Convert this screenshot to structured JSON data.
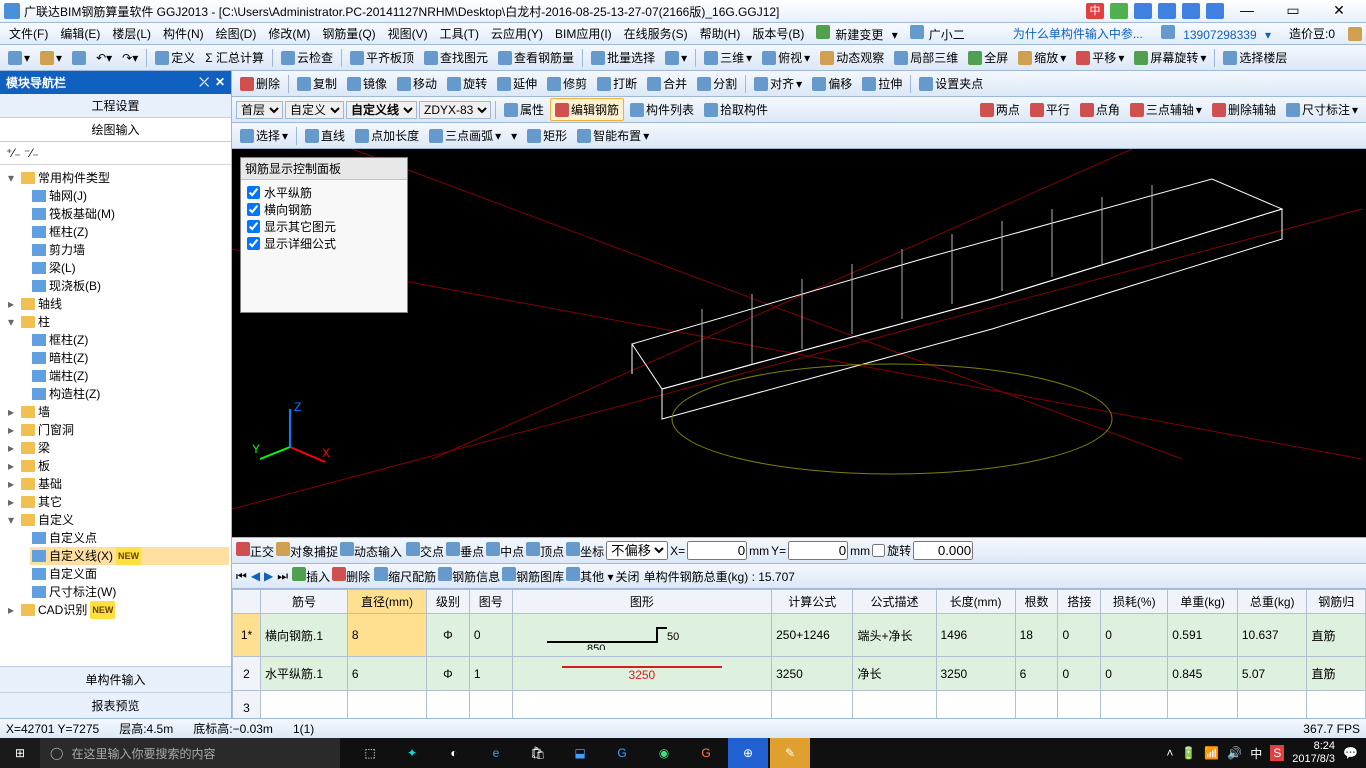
{
  "title": "广联达BIM钢筋算量软件 GGJ2013 - [C:\\Users\\Administrator.PC-20141127NRHM\\Desktop\\白龙村-2016-08-25-13-27-07(2166版)_16G.GGJ12]",
  "ime_text": "中",
  "menubar": [
    "文件(F)",
    "编辑(E)",
    "楼层(L)",
    "构件(N)",
    "绘图(D)",
    "修改(M)",
    "钢筋量(Q)",
    "视图(V)",
    "工具(T)",
    "云应用(Y)",
    "BIM应用(I)",
    "在线服务(S)",
    "帮助(H)",
    "版本号(B)"
  ],
  "menubar_right": {
    "new_change": "新建变更",
    "xiaoer": "广小二",
    "hint": "为什么单构件输入中参...",
    "phone": "13907298339",
    "coin": "造价豆:0"
  },
  "toolbar": [
    "定义",
    "Σ 汇总计算",
    "云检查",
    "平齐板顶",
    "查找图元",
    "查看钢筋量",
    "批量选择",
    "三维",
    "俯视",
    "动态观察",
    "局部三维",
    "全屏",
    "缩放",
    "平移",
    "屏幕旋转",
    "选择楼层"
  ],
  "nav": {
    "title": "模块导航栏",
    "tabs": {
      "project": "工程设置",
      "draw": "绘图输入"
    },
    "tree": {
      "root": "常用构件类型",
      "common": [
        "轴网(J)",
        "筏板基础(M)",
        "框柱(Z)",
        "剪力墙",
        "梁(L)",
        "现浇板(B)"
      ],
      "branches": [
        {
          "name": "轴线"
        },
        {
          "name": "柱",
          "children": [
            "框柱(Z)",
            "暗柱(Z)",
            "端柱(Z)",
            "构造柱(Z)"
          ]
        },
        {
          "name": "墙"
        },
        {
          "name": "门窗洞"
        },
        {
          "name": "梁"
        },
        {
          "name": "板"
        },
        {
          "name": "基础"
        },
        {
          "name": "其它"
        },
        {
          "name": "自定义",
          "children": [
            "自定义点",
            "自定义线(X)",
            "自定义面",
            "尺寸标注(W)"
          ]
        },
        {
          "name": "CAD识别"
        }
      ]
    },
    "bottom": [
      "单构件输入",
      "报表预览"
    ]
  },
  "worktb1": {
    "copy": "复制",
    "mirror": "镜像",
    "move": "移动",
    "rotate": "旋转",
    "extend": "延伸",
    "trim": "修剪",
    "break": "打断",
    "merge": "合并",
    "split": "分割",
    "align": "对齐",
    "offset": "偏移",
    "stretch": "拉伸",
    "setpt": "设置夹点",
    "delete": "删除"
  },
  "worktb2": {
    "floor": "首层",
    "user": "自定义",
    "userline": "自定义线",
    "code": "ZDYX-83",
    "attr": "属性",
    "editrebar": "编辑钢筋",
    "list": "构件列表",
    "pick": "拾取构件",
    "twopt": "两点",
    "parallel": "平行",
    "corner": "点角",
    "threept": "三点辅轴",
    "delaux": "删除辅轴",
    "dim": "尺寸标注"
  },
  "worktb3": {
    "select": "选择",
    "line": "直线",
    "ptlen": "点加长度",
    "arc": "三点画弧",
    "rect": "矩形",
    "smart": "智能布置"
  },
  "display_panel": {
    "title": "钢筋显示控制面板",
    "opts": [
      "水平纵筋",
      "横向钢筋",
      "显示其它图元",
      "显示详细公式"
    ]
  },
  "snapbar": {
    "ortho": "正交",
    "snap": "对象捕捉",
    "dyn": "动态输入",
    "intr": "交点",
    "perp": "垂点",
    "mid": "中点",
    "vert": "顶点",
    "grid": "坐标",
    "offset": "不偏移",
    "x": "X=",
    "xval": "0",
    "mm": "mm",
    "y": "Y=",
    "yval": "0",
    "rot": "旋转",
    "rotval": "0.000"
  },
  "rebarctl": {
    "insert": "插入",
    "delete": "删除",
    "scale": "缩尺配筋",
    "info": "钢筋信息",
    "lib": "钢筋图库",
    "other": "其他",
    "close": "关闭",
    "total": "单构件钢筋总重(kg) : 15.707"
  },
  "table": {
    "headers": [
      "",
      "筋号",
      "直径(mm)",
      "级别",
      "图号",
      "图形",
      "计算公式",
      "公式描述",
      "长度(mm)",
      "根数",
      "搭接",
      "损耗(%)",
      "单重(kg)",
      "总重(kg)",
      "钢筋归"
    ],
    "rows": [
      {
        "idx": "1*",
        "name": "横向钢筋.1",
        "dia": "8",
        "grade": "Φ",
        "fig": "0",
        "g_lbl_l": "850",
        "g_lbl_r": "50",
        "formula": "250+1246",
        "desc": "端头+净长",
        "len": "1496",
        "num": "18",
        "lap": "0",
        "loss": "0",
        "uw": "0.591",
        "tw": "10.637",
        "cat": "直筋"
      },
      {
        "idx": "2",
        "name": "水平纵筋.1",
        "dia": "6",
        "grade": "Φ",
        "fig": "1",
        "g_lbl": "3250",
        "formula": "3250",
        "desc": "净长",
        "len": "3250",
        "num": "6",
        "lap": "0",
        "loss": "0",
        "uw": "0.845",
        "tw": "5.07",
        "cat": "直筋"
      },
      {
        "idx": "3"
      }
    ]
  },
  "statusbar": {
    "coords": "X=42701 Y=7275",
    "floor": "层高:4.5m",
    "base": "底标高:−0.03m",
    "sel": "1(1)",
    "fps": "367.7 FPS"
  },
  "taskbar": {
    "search": "在这里输入你要搜索的内容",
    "time": "8:24",
    "date": "2017/8/3",
    "ime": "中"
  }
}
